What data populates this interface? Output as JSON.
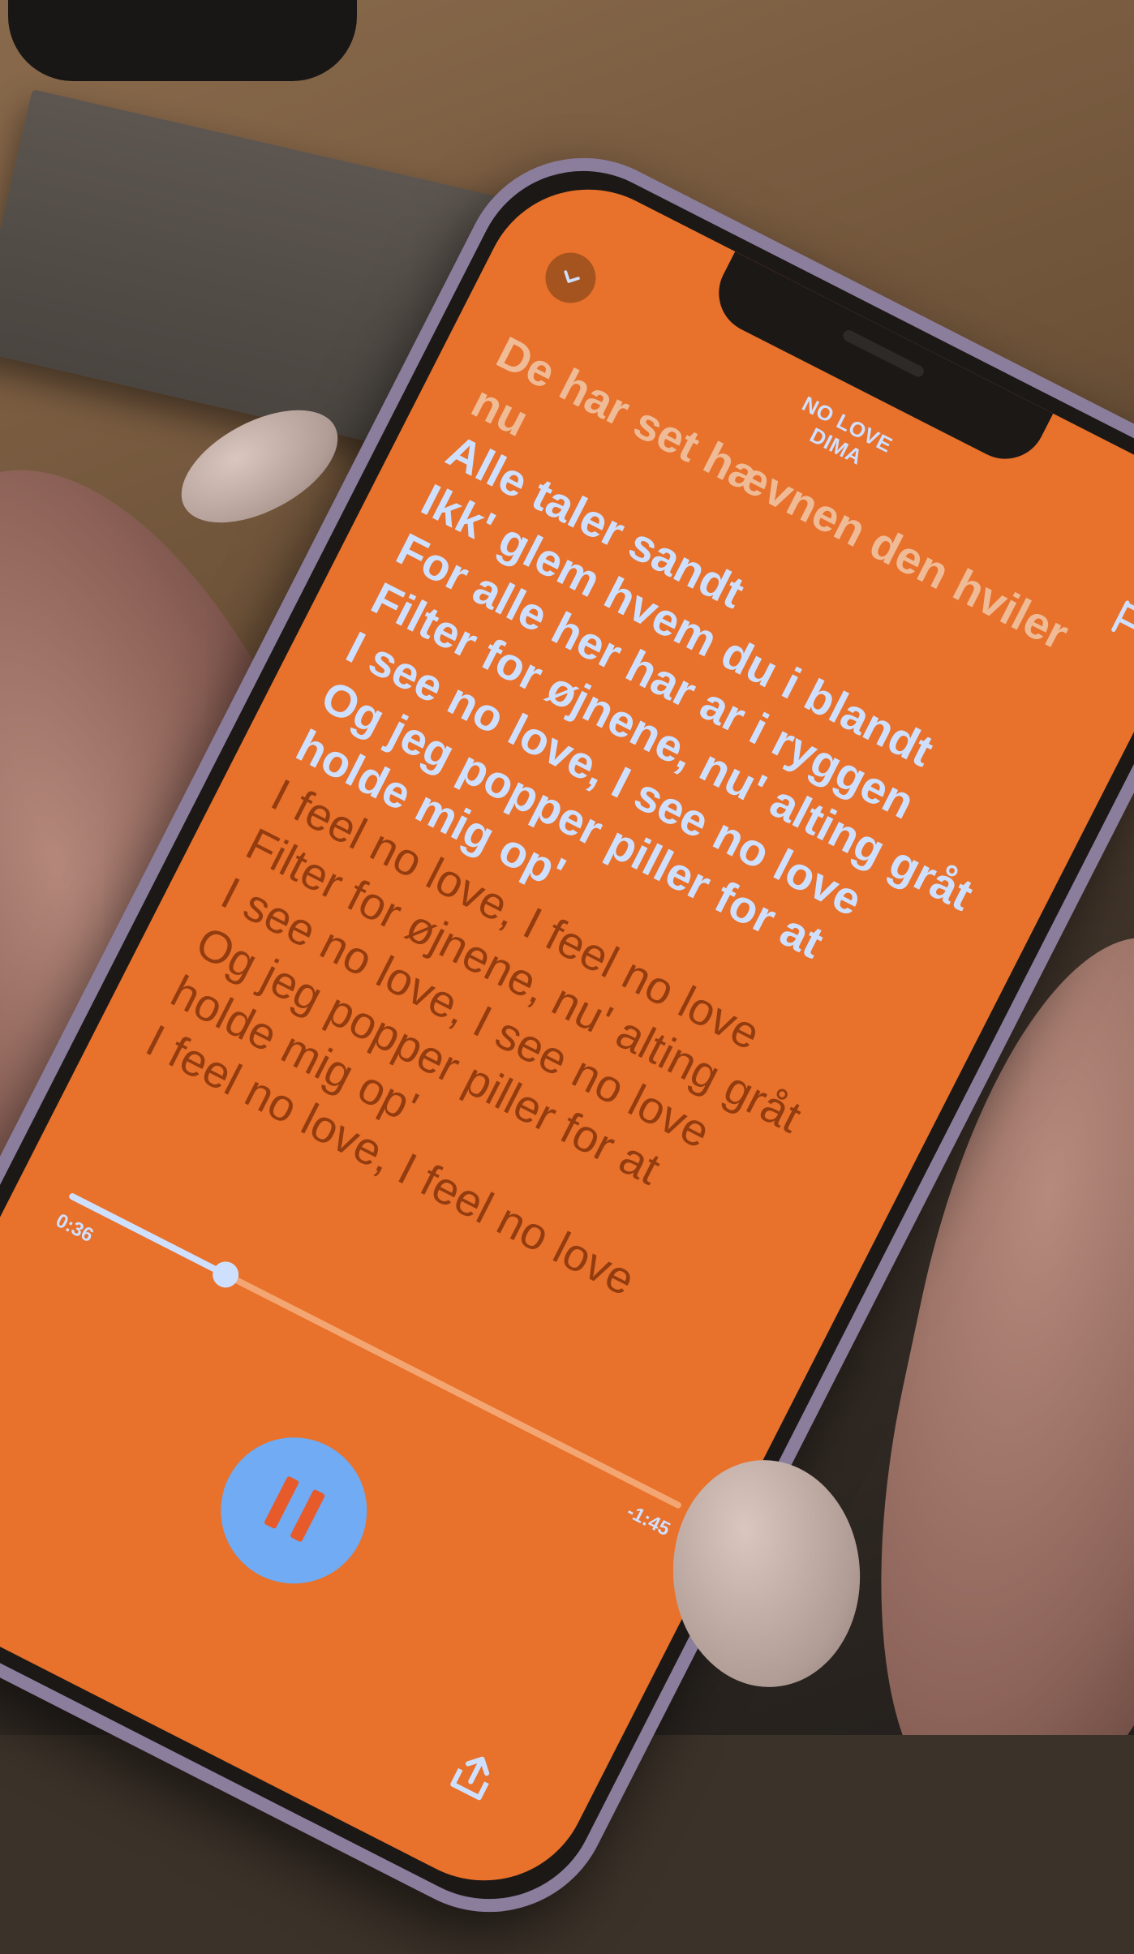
{
  "header": {
    "track_title": "NO LOVE",
    "artist": "DIMA"
  },
  "lyrics": {
    "past": [
      "De har set hævnen den hviler",
      "nu"
    ],
    "current": [
      "Alle taler sandt",
      "Ikk' glem hvem du i blandt",
      "For alle her har ar i ryggen",
      "Filter for øjnene, nu' alting gråt",
      "I see no love, I see no love",
      "Og jeg popper piller for at",
      "holde mig op'"
    ],
    "upcoming": [
      "I feel no love, I feel no love",
      "Filter for øjnene, nu' alting gråt",
      "I see no love, I see no love",
      "Og jeg popper piller for at",
      "holde mig op'",
      "I feel no love, I feel no love"
    ]
  },
  "player": {
    "elapsed": "0:36",
    "remaining": "-1:45",
    "progress_fraction": 0.255
  },
  "icons": {
    "collapse": "chevron-down-icon",
    "flag": "flag-icon",
    "play_pause": "pause-icon",
    "share": "share-icon"
  },
  "colors": {
    "background": "#e8712b",
    "accent": "#cfe0ff",
    "upcoming_text": "#933c0f",
    "button": "#70abf3"
  }
}
